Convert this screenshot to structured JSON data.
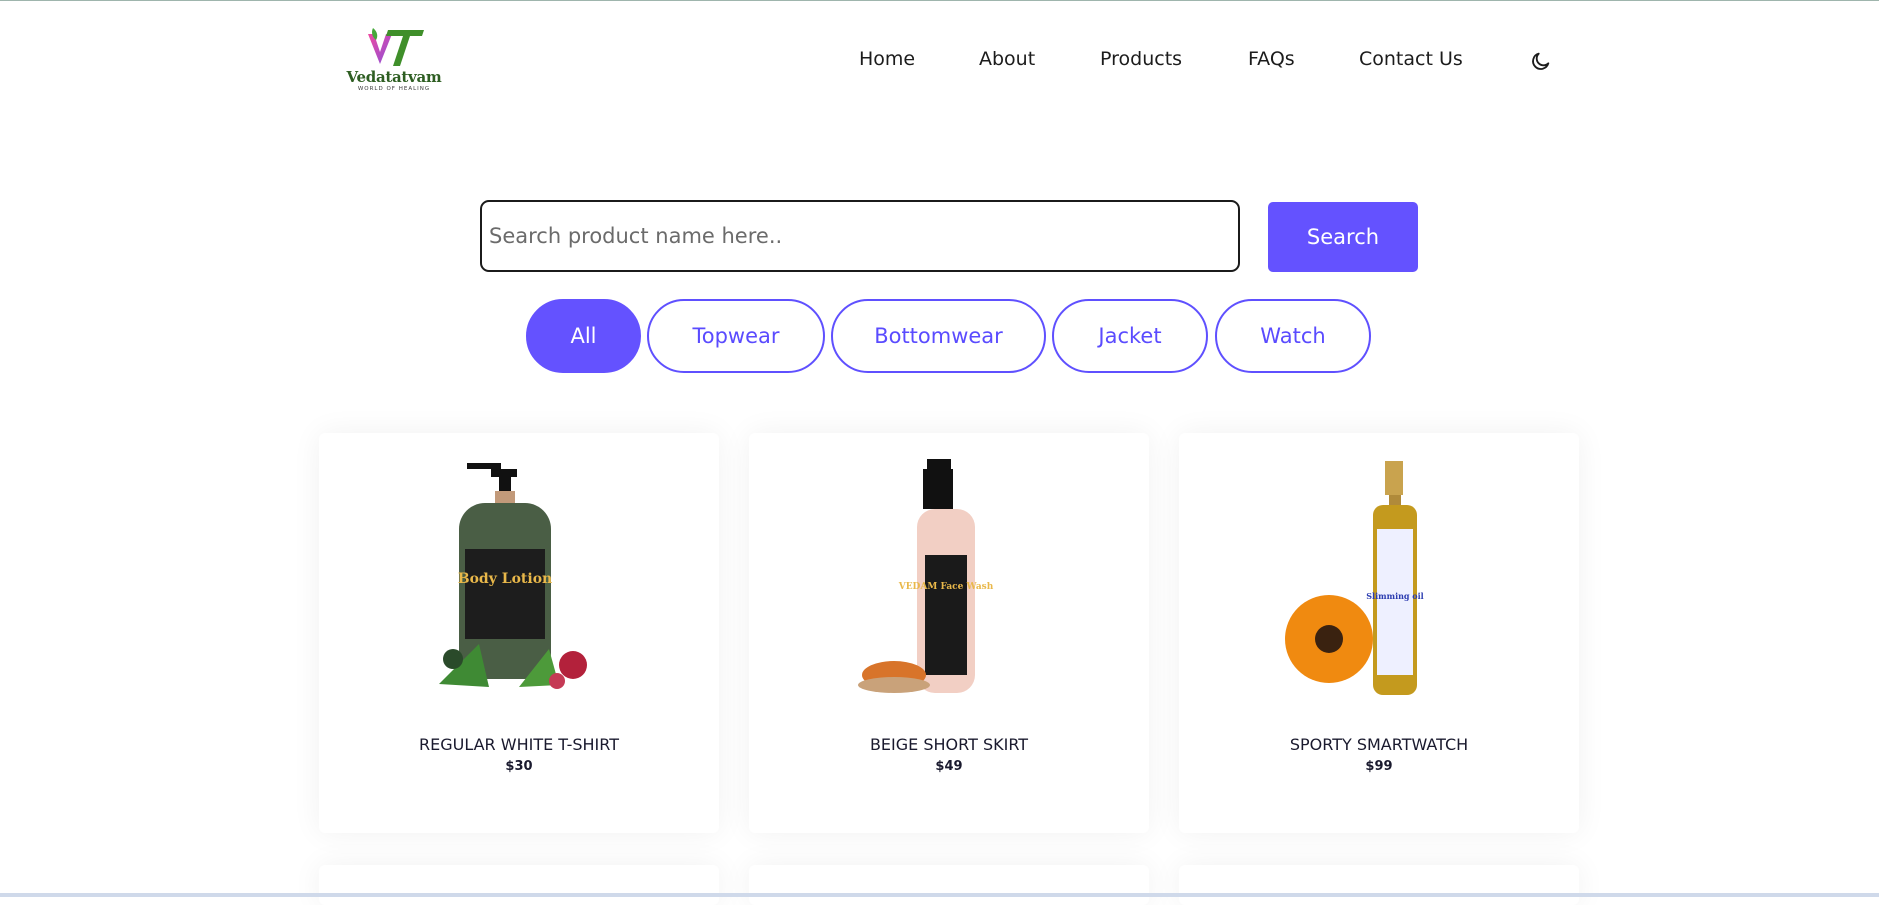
{
  "brand": {
    "name": "Vedatatvam",
    "tagline": "WORLD OF HEALING"
  },
  "nav": {
    "items": [
      {
        "label": "Home"
      },
      {
        "label": "About"
      },
      {
        "label": "Products"
      },
      {
        "label": "FAQs"
      },
      {
        "label": "Contact Us"
      }
    ],
    "theme_toggle_icon": "moon-icon"
  },
  "search": {
    "placeholder": "Search product name here..",
    "value": "",
    "button_label": "Search"
  },
  "filters": {
    "active": "All",
    "items": [
      {
        "label": "All"
      },
      {
        "label": "Topwear"
      },
      {
        "label": "Bottomwear"
      },
      {
        "label": "Jacket"
      },
      {
        "label": "Watch"
      }
    ]
  },
  "products": [
    {
      "title": "REGULAR WHITE T-SHIRT",
      "price": "$30",
      "image_label": "Body Lotion"
    },
    {
      "title": "BEIGE SHORT SKIRT",
      "price": "$49",
      "image_label": "VEDAM Face Wash"
    },
    {
      "title": "SPORTY SMARTWATCH",
      "price": "$99",
      "image_label": "Slimming oil"
    }
  ],
  "colors": {
    "accent": "#6452ff",
    "brand_green": "#2e5e22"
  }
}
